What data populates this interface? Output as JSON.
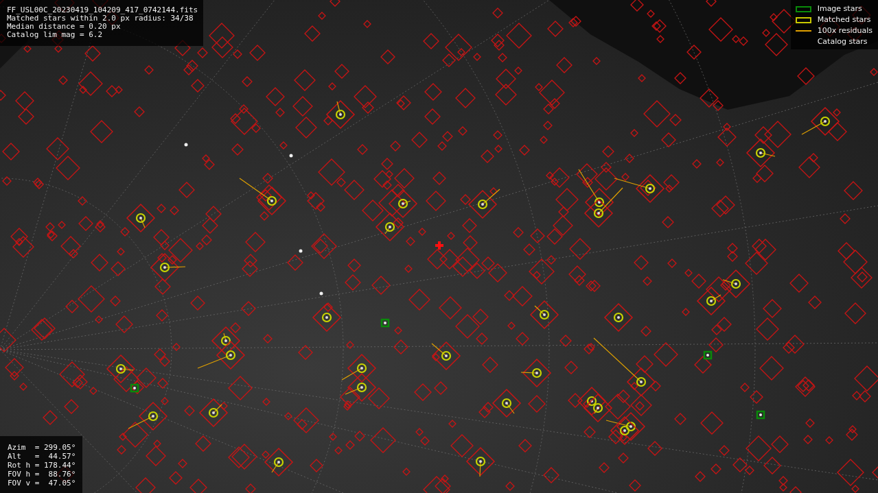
{
  "info_box": {
    "lines": [
      "FF_USL00C_20230419_104209_417_0742144.fits",
      "Matched stars within 2.0 px radius: 34/38",
      "Median distance = 0.20 px",
      "Catalog lim mag = 6.2"
    ]
  },
  "legend": {
    "items": [
      {
        "kind": "image",
        "label": "Image stars"
      },
      {
        "kind": "matched",
        "label": "Matched stars"
      },
      {
        "kind": "residual",
        "label": "100x residuals"
      },
      {
        "kind": "catalog",
        "label": "Catalog stars"
      }
    ]
  },
  "pointing_box": {
    "lines": [
      "Azim  = 299.05°",
      "Alt   =  44.57°",
      "Rot h = 178.44°",
      "FOV h =  88.76°",
      "FOV v =  47.05°"
    ]
  }
}
